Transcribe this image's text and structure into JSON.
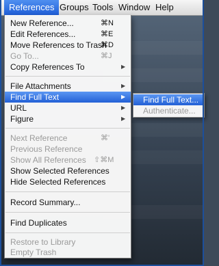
{
  "menubar": {
    "items": [
      {
        "label": "References"
      },
      {
        "label": "Groups"
      },
      {
        "label": "Tools"
      },
      {
        "label": "Window"
      },
      {
        "label": "Help"
      }
    ]
  },
  "menu": {
    "new_reference": {
      "label": "New Reference...",
      "shortcut": "⌘N"
    },
    "edit_references": {
      "label": "Edit References...",
      "shortcut": "⌘E"
    },
    "move_to_trash": {
      "label": "Move References to Trash",
      "shortcut": "⌘D"
    },
    "go_to": {
      "label": "Go To...",
      "shortcut": "⌘J"
    },
    "copy_references_to": {
      "label": "Copy References To"
    },
    "file_attachments": {
      "label": "File Attachments"
    },
    "find_full_text": {
      "label": "Find Full Text"
    },
    "url": {
      "label": "URL"
    },
    "figure": {
      "label": "Figure"
    },
    "next_reference": {
      "label": "Next Reference",
      "shortcut": "⌘'"
    },
    "previous_reference": {
      "label": "Previous Reference"
    },
    "show_all_references": {
      "label": "Show All References",
      "shortcut": "⇧⌘M"
    },
    "show_selected_references": {
      "label": "Show Selected References"
    },
    "hide_selected_references": {
      "label": "Hide Selected References"
    },
    "record_summary": {
      "label": "Record Summary..."
    },
    "find_duplicates": {
      "label": "Find Duplicates"
    },
    "restore_to_library": {
      "label": "Restore to Library"
    },
    "empty_trash": {
      "label": "Empty Trash"
    }
  },
  "submenu": {
    "find_full_text": {
      "label": "Find Full Text..."
    },
    "authenticate": {
      "label": "Authenticate..."
    }
  },
  "colors": {
    "highlight": "#2360d6",
    "disabled_text": "#9a9a9a",
    "menu_background": "#f8f8f8"
  }
}
